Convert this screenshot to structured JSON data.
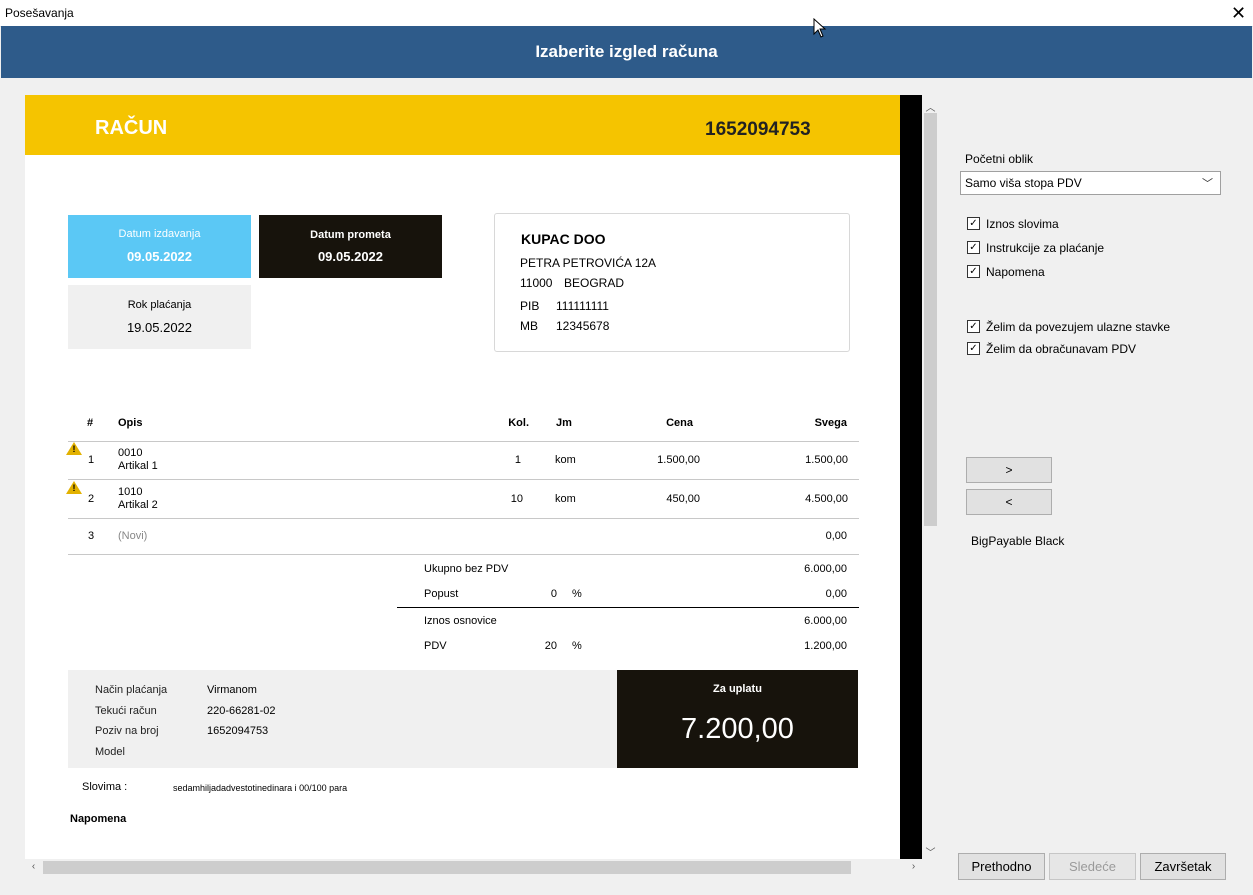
{
  "window": {
    "title": "Posešavanja",
    "close": "✕"
  },
  "header": {
    "title": "Izaberite izgled računa"
  },
  "invoice": {
    "heading": "RAČUN",
    "number": "1652094753",
    "issue_label": "Datum izdavanja",
    "issue_date": "09.05.2022",
    "turnover_label": "Datum prometa",
    "turnover_date": "09.05.2022",
    "due_label": "Rok plaćanja",
    "due_date": "19.05.2022",
    "buyer": {
      "name": "KUPAC DOO",
      "street": "PETRA PETROVIĆA 12A",
      "zip": "11000",
      "city": "BEOGRAD",
      "pib_label": "PIB",
      "pib": "111111111",
      "mb_label": "MB",
      "mb": "12345678"
    },
    "table": {
      "headers": {
        "num": "#",
        "desc": "Opis",
        "qty": "Kol.",
        "unit": "Jm",
        "price": "Cena",
        "total": "Svega"
      },
      "rows": [
        {
          "num": "1",
          "code": "0010",
          "name": "Artikal 1",
          "qty": "1",
          "unit": "kom",
          "price": "1.500,00",
          "total": "1.500,00"
        },
        {
          "num": "2",
          "code": "1010",
          "name": "Artikal 2",
          "qty": "10",
          "unit": "kom",
          "price": "450,00",
          "total": "4.500,00"
        }
      ],
      "new_row": {
        "num": "3",
        "label": "(Novi)",
        "total": "0,00"
      }
    },
    "totals": {
      "subtotal_label": "Ukupno bez PDV",
      "subtotal": "6.000,00",
      "discount_label": "Popust",
      "discount_pct": "0",
      "discount_pct_sign": "%",
      "discount": "0,00",
      "base_label": "Iznos osnovice",
      "base": "6.000,00",
      "vat_label": "PDV",
      "vat_pct": "20",
      "vat_pct_sign": "%",
      "vat": "1.200,00"
    },
    "payment": {
      "method_label": "Način plaćanja",
      "method": "Virmanom",
      "account_label": "Tekući račun",
      "account": "220-66281-02",
      "ref_label": "Poziv na broj",
      "ref": "1652094753",
      "model_label": "Model"
    },
    "to_pay_label": "Za uplatu",
    "to_pay": "7.200,00",
    "words_label": "Slovima :",
    "words": "sedamhiljadadvestotinedinara i 00/100 para",
    "note_label": "Napomena"
  },
  "panel": {
    "initial_label": "Početni oblik",
    "initial_value": "Samo viša stopa PDV",
    "checks": [
      {
        "label": "Iznos slovima",
        "checked": true
      },
      {
        "label": "Instrukcije za plaćanje",
        "checked": true
      },
      {
        "label": "Napomena",
        "checked": true
      }
    ],
    "checks2": [
      {
        "label": "Želim da povezujem ulazne stavke",
        "checked": true
      },
      {
        "label": "Želim da obračunavam PDV",
        "checked": true
      }
    ],
    "next_btn": ">",
    "prev_btn": "<",
    "template_name": "BigPayable Black"
  },
  "footer": {
    "prev": "Prethodno",
    "next": "Sledeće",
    "finish": "Završetak"
  },
  "colors": {
    "header": "#2e5b8a",
    "accent_yellow": "#f5c400",
    "accent_blue": "#5bc8f5",
    "dark": "#17130c"
  }
}
